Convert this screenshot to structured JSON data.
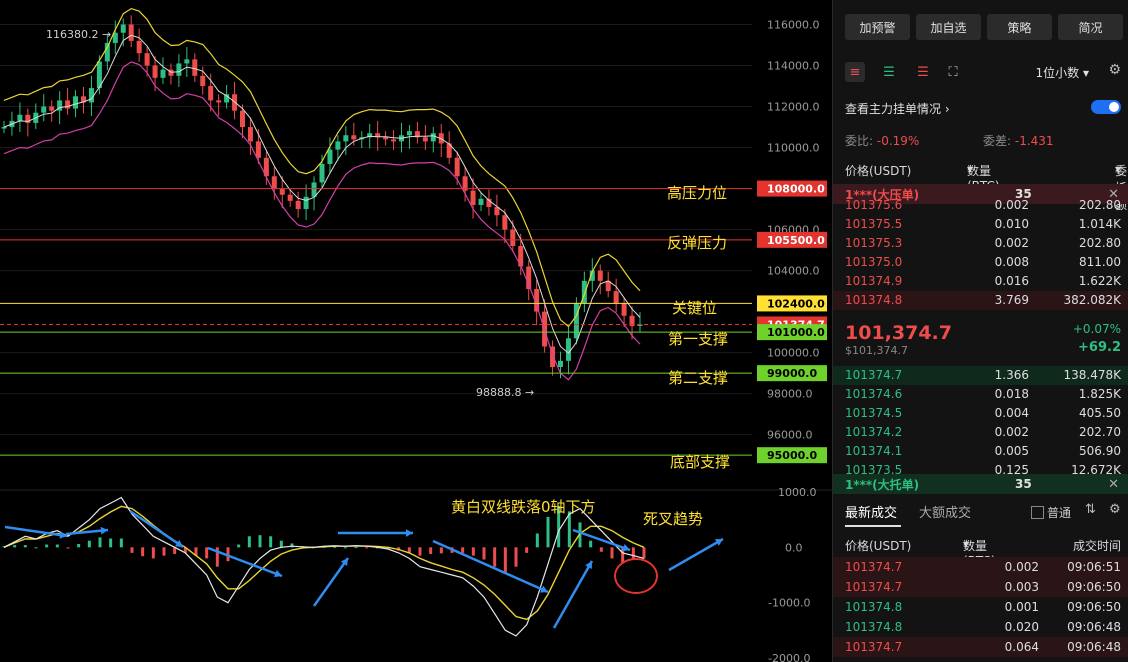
{
  "chart_data": {
    "type": "candlestick",
    "ylabel": "",
    "y_ticks": [
      "116000.0",
      "114000.0",
      "112000.0",
      "110000.0",
      "106000.0",
      "104000.0",
      "100000.0",
      "98000.0",
      "96000.0"
    ],
    "macd_ticks": [
      "1000.0",
      "0.0",
      "-1000.0",
      "-2000.0"
    ],
    "high_marker": "116380.2",
    "low_marker": "98888.8",
    "levels": [
      {
        "label": "108000.0",
        "value": 108000,
        "color": "#e3342f",
        "text": "#ffffff"
      },
      {
        "label": "105500.0",
        "value": 105500,
        "color": "#e3342f",
        "text": "#ffffff"
      },
      {
        "label": "102400.0",
        "value": 102400,
        "color": "#ffe033",
        "text": "#000000"
      },
      {
        "label": "101374.7",
        "value": 101374.7,
        "color": "#e3342f",
        "text": "#ffffff",
        "dashed": true
      },
      {
        "label": "101000.0",
        "value": 101000,
        "color": "#6fd22c",
        "text": "#000000"
      },
      {
        "label": "99000.0",
        "value": 99000,
        "color": "#6fd22c",
        "text": "#000000"
      },
      {
        "label": "95000.0",
        "value": 95000,
        "color": "#6fd22c",
        "text": "#000000"
      }
    ],
    "price_range": [
      93400,
      117000
    ],
    "macd_range": [
      -2000,
      1000
    ],
    "closes": [
      111000,
      111300,
      111600,
      111200,
      111700,
      112000,
      111800,
      112300,
      111900,
      112500,
      112200,
      112900,
      114200,
      115100,
      115600,
      116000,
      115200,
      114600,
      114000,
      113400,
      113800,
      113500,
      114100,
      114300,
      113500,
      113000,
      112300,
      112200,
      112600,
      111800,
      111000,
      110300,
      109500,
      108600,
      108000,
      107700,
      107400,
      107000,
      107600,
      108300,
      109200,
      109900,
      110300,
      110600,
      110400,
      110500,
      110700,
      110500,
      110400,
      110300,
      110600,
      110800,
      110500,
      110300,
      110700,
      110200,
      109500,
      108600,
      107900,
      107200,
      107500,
      107100,
      106700,
      106000,
      105200,
      104200,
      103100,
      102000,
      100300,
      99300,
      99600,
      100700,
      102400,
      103500,
      104000,
      103500,
      103000,
      102400,
      101800,
      101300,
      101374
    ],
    "macd_dif": [
      0,
      100,
      200,
      150,
      250,
      300,
      200,
      350,
      500,
      700,
      800,
      900,
      600,
      400,
      200,
      100,
      0,
      -100,
      -300,
      -500,
      -900,
      -1000,
      -700,
      -400,
      -200,
      -50,
      0,
      20,
      10,
      0,
      20,
      30,
      20,
      30,
      20,
      0,
      -30,
      -100,
      -200,
      -350,
      -400,
      -450,
      -500,
      -550,
      -700,
      -900,
      -1200,
      -1500,
      -1600,
      -1400,
      -900,
      -300,
      300,
      600,
      700,
      500,
      300,
      100,
      -100,
      -150,
      -200
    ],
    "macd_dea": [
      0,
      80,
      150,
      150,
      200,
      250,
      220,
      280,
      380,
      520,
      640,
      740,
      700,
      560,
      400,
      250,
      120,
      0,
      -150,
      -300,
      -550,
      -750,
      -750,
      -600,
      -420,
      -250,
      -120,
      -50,
      -10,
      0,
      10,
      20,
      20,
      25,
      22,
      15,
      0,
      -40,
      -100,
      -200,
      -280,
      -340,
      -400,
      -450,
      -550,
      -680,
      -850,
      -1050,
      -1250,
      -1300,
      -1150,
      -850,
      -450,
      -50,
      250,
      380,
      380,
      300,
      180,
      80,
      0
    ],
    "macd_hist": [
      20,
      40,
      40,
      0,
      50,
      50,
      -20,
      60,
      120,
      180,
      160,
      160,
      -100,
      -160,
      -200,
      -150,
      -120,
      -100,
      -150,
      -200,
      -350,
      -250,
      50,
      200,
      220,
      200,
      120,
      70,
      20,
      0,
      10,
      10,
      0,
      5,
      -2,
      -15,
      -30,
      -60,
      -100,
      -150,
      -120,
      -110,
      -100,
      -100,
      -150,
      -220,
      -350,
      -450,
      -350,
      -100,
      250,
      550,
      750,
      650,
      450,
      120,
      -80,
      -200,
      -280,
      -230,
      -200
    ]
  },
  "annotations": {
    "high_pressure": "高压力位",
    "rebound_pressure": "反弹压力",
    "key_level": "关键位",
    "support1": "第一支撑",
    "support2": "第二支撑",
    "bottom_support": "底部支撑",
    "macd_note": "黄白双线跌落0轴下方",
    "death_cross": "死叉趋势"
  },
  "panel": {
    "buttons": [
      "加预警",
      "加自选",
      "策略",
      "简况"
    ],
    "decimal": "1位小数",
    "main_orders_label": "查看主力挂单情况",
    "ratio_label": "委比:",
    "ratio_value": "-0.19%",
    "diff_label": "委差:",
    "diff_value": "-1.431",
    "col_price": "价格(USDT)",
    "col_qty": "数量 (BTC)",
    "col_amount": "委托额",
    "ask_bar_label": "1***(大压单)",
    "ask_bar_num": "35",
    "asks": [
      {
        "price": "101375.6",
        "qty": "0.002",
        "amt": "202.80"
      },
      {
        "price": "101375.5",
        "qty": "0.010",
        "amt": "1.014K"
      },
      {
        "price": "101375.3",
        "qty": "0.002",
        "amt": "202.80"
      },
      {
        "price": "101375.0",
        "qty": "0.008",
        "amt": "811.00"
      },
      {
        "price": "101374.9",
        "qty": "0.016",
        "amt": "1.622K"
      },
      {
        "price": "101374.8",
        "qty": "3.769",
        "amt": "382.082K"
      }
    ],
    "last_price": "101,374.7",
    "last_price_usd": "$101,374.7",
    "change_pct": "+0.07%",
    "change_abs": "+69.2",
    "bids": [
      {
        "price": "101374.7",
        "qty": "1.366",
        "amt": "138.478K"
      },
      {
        "price": "101374.6",
        "qty": "0.018",
        "amt": "1.825K"
      },
      {
        "price": "101374.5",
        "qty": "0.004",
        "amt": "405.50"
      },
      {
        "price": "101374.2",
        "qty": "0.002",
        "amt": "202.70"
      },
      {
        "price": "101374.1",
        "qty": "0.005",
        "amt": "506.90"
      },
      {
        "price": "101373.5",
        "qty": "0.125",
        "amt": "12.672K"
      }
    ],
    "bid_bar_label": "1***(大托单)",
    "bid_bar_num": "35",
    "tab_latest": "最新成交",
    "tab_large": "大额成交",
    "normal": "普通",
    "trade_col_price": "价格(USDT)",
    "trade_col_qty": "数量(BTC)",
    "trade_col_time": "成交时间",
    "trades": [
      {
        "price": "101374.7",
        "qty": "0.002",
        "time": "09:06:51",
        "side": "sell"
      },
      {
        "price": "101374.7",
        "qty": "0.003",
        "time": "09:06:50",
        "side": "sell"
      },
      {
        "price": "101374.8",
        "qty": "0.001",
        "time": "09:06:50",
        "side": "buy"
      },
      {
        "price": "101374.8",
        "qty": "0.020",
        "time": "09:06:48",
        "side": "buy"
      },
      {
        "price": "101374.7",
        "qty": "0.064",
        "time": "09:06:48",
        "side": "sell"
      }
    ]
  },
  "colors": {
    "up": "#2dbf83",
    "down": "#ef4c4c",
    "accent": "#ffe033",
    "toggle": "#1e6ff2"
  }
}
